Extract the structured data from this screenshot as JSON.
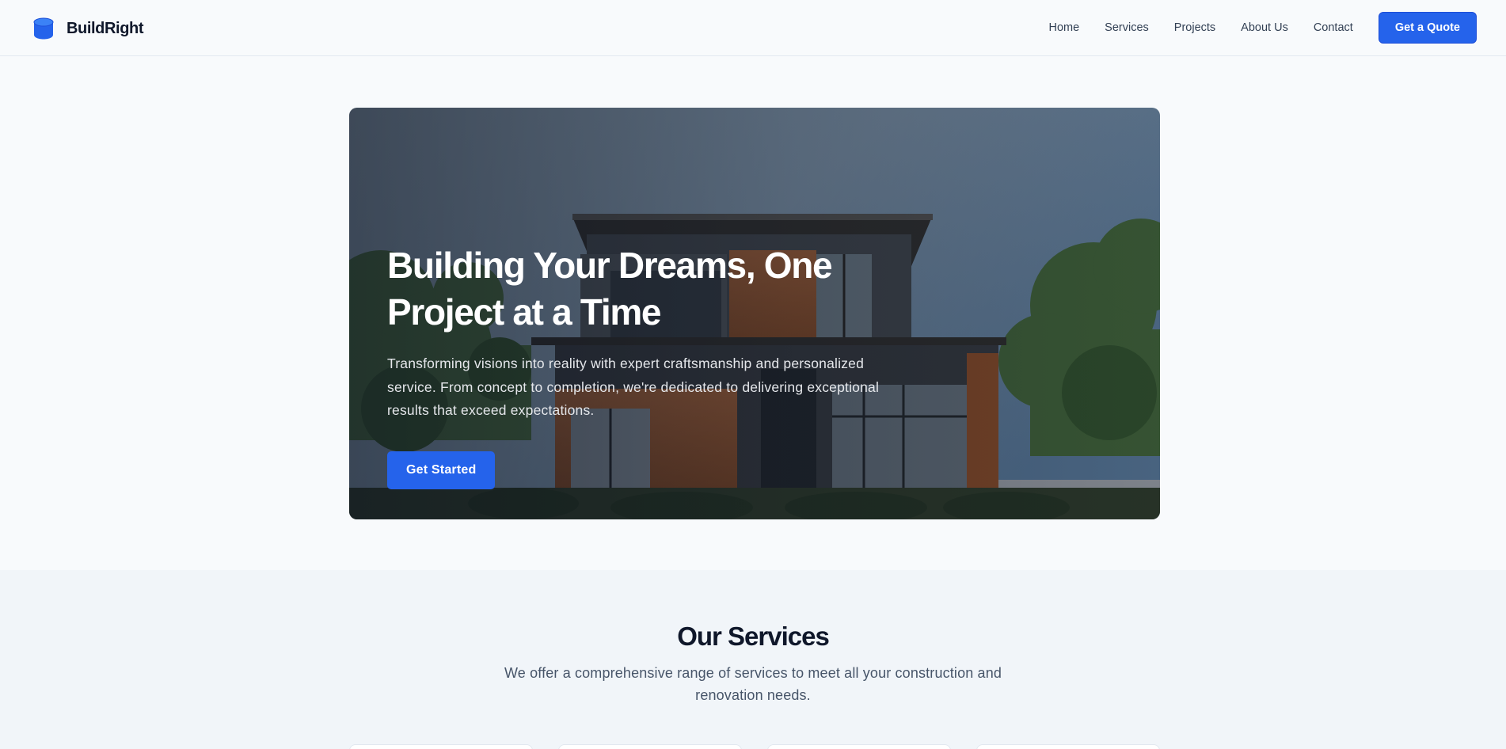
{
  "header": {
    "brand_name": "BuildRight",
    "brand_icon": "database-cylinder-icon",
    "nav": [
      {
        "label": "Home"
      },
      {
        "label": "Services"
      },
      {
        "label": "Projects"
      },
      {
        "label": "About Us"
      },
      {
        "label": "Contact"
      }
    ],
    "cta_label": "Get a Quote"
  },
  "hero": {
    "title": "Building Your Dreams, One Project at a Time",
    "description": "Transforming visions into reality with expert craftsmanship and personalized service. From concept to completion, we're dedicated to delivering exceptional results that exceed expectations.",
    "button_label": "Get Started"
  },
  "services": {
    "title": "Our Services",
    "description": "We offer a comprehensive range of services to meet all your construction and renovation needs."
  },
  "colors": {
    "accent": "#2563eb",
    "page_bg": "#f8fafc",
    "services_bg": "#f1f5f9",
    "heading": "#0f172a"
  }
}
